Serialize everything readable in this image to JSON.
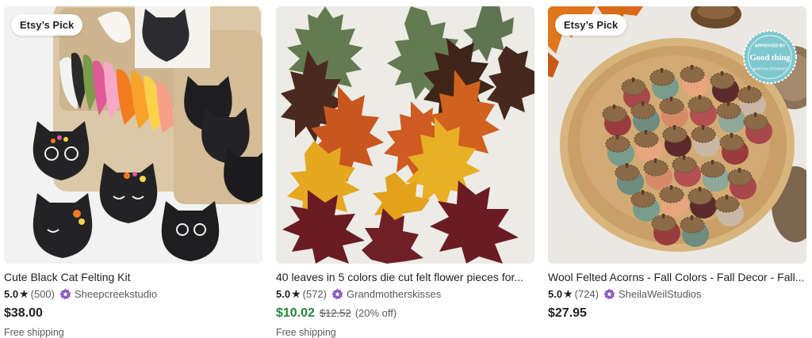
{
  "listings": [
    {
      "badge": "Etsy’s Pick",
      "image_icon": "black-cat-felting-kit-photo",
      "title": "Cute Black Cat Felting Kit",
      "rating": "5.0",
      "review_count": "(500)",
      "shop_icon": "star-seller-badge-icon",
      "shop": "Sheepcreekstudio",
      "price": "$38.00",
      "shipping": "Free shipping"
    },
    {
      "image_icon": "felt-autumn-leaves-photo",
      "title": "40 leaves in 5 colors die cut felt flower pieces for...",
      "rating": "5.0",
      "review_count": "(572)",
      "shop_icon": "star-seller-badge-icon",
      "shop": "Grandmotherskisses",
      "price": "$10.02",
      "original_price": "$12.52",
      "discount": "(20% off)",
      "shipping": "Free shipping"
    },
    {
      "badge": "Etsy’s Pick",
      "image_icon": "wool-felted-acorns-photo",
      "title": "Wool Felted Acorns - Fall Colors - Fall Decor - Fall...",
      "rating": "5.0",
      "review_count": "(724)",
      "shop_icon": "star-seller-badge-icon",
      "shop": "SheilaWeilStudios",
      "price": "$27.95",
      "seal": {
        "top": "APPROVED BY",
        "main": "Good thing",
        "bottom": "MARTHA STEWART"
      }
    }
  ],
  "colors": {
    "sale_price": "#258635",
    "star_seller": "#8a5bbd",
    "text": "#222222",
    "muted": "#595959"
  }
}
